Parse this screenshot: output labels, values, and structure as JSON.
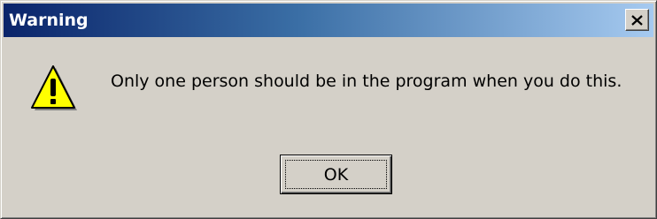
{
  "window": {
    "title": "Warning",
    "close_icon": "close-icon"
  },
  "content": {
    "icon": "warning-icon",
    "message": "Only one person should be in the program when you do this."
  },
  "buttons": {
    "ok_label": "OK"
  },
  "colors": {
    "titlebar_start": "#0a246a",
    "titlebar_end": "#a6caf0",
    "face": "#d4d0c8",
    "warning_yellow": "#ffff00"
  }
}
